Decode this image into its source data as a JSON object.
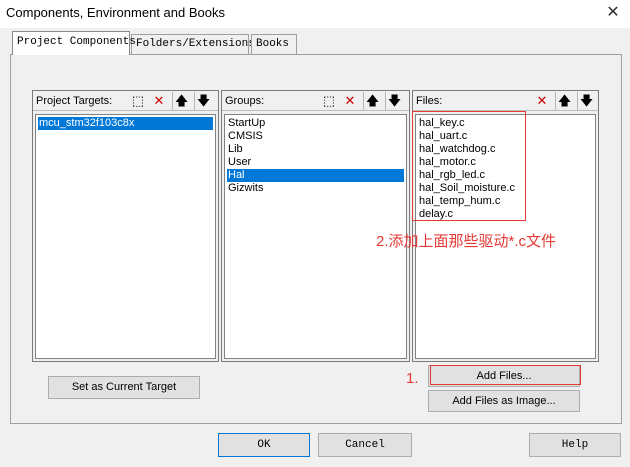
{
  "window": {
    "title": "Components, Environment and Books",
    "close_glyph": "✕"
  },
  "tabs": [
    {
      "label": "Project Components"
    },
    {
      "label": "Folders/Extensions"
    },
    {
      "label": "Books"
    }
  ],
  "targets": {
    "header": "Project Targets:",
    "items": [
      "mcu_stm32f103c8x"
    ],
    "selected": 0
  },
  "groups": {
    "header": "Groups:",
    "items": [
      "StartUp",
      "CMSIS",
      "Lib",
      "User",
      "Hal",
      "Gizwits"
    ],
    "selected": 4
  },
  "files": {
    "header": "Files:",
    "items": [
      "hal_key.c",
      "hal_uart.c",
      "hal_watchdog.c",
      "hal_motor.c",
      "hal_rgb_led.c",
      "hal_Soil_moisture.c",
      "hal_temp_hum.c",
      "delay.c"
    ]
  },
  "toolbar_glyphs": {
    "new": "⬚",
    "delete": "✕",
    "up": "🡅",
    "down": "🡇"
  },
  "buttons": {
    "set_current": "Set as Current Target",
    "add_files": "Add Files...",
    "add_files_image": "Add Files as Image...",
    "ok": "OK",
    "cancel": "Cancel",
    "help": "Help"
  },
  "annotations": {
    "note1": "1.",
    "note2": "2.添加上面那些驱动*.c文件"
  },
  "colors": {
    "selection": "#0078d7",
    "annotation": "#e53935",
    "delete_icon": "#d00000"
  }
}
